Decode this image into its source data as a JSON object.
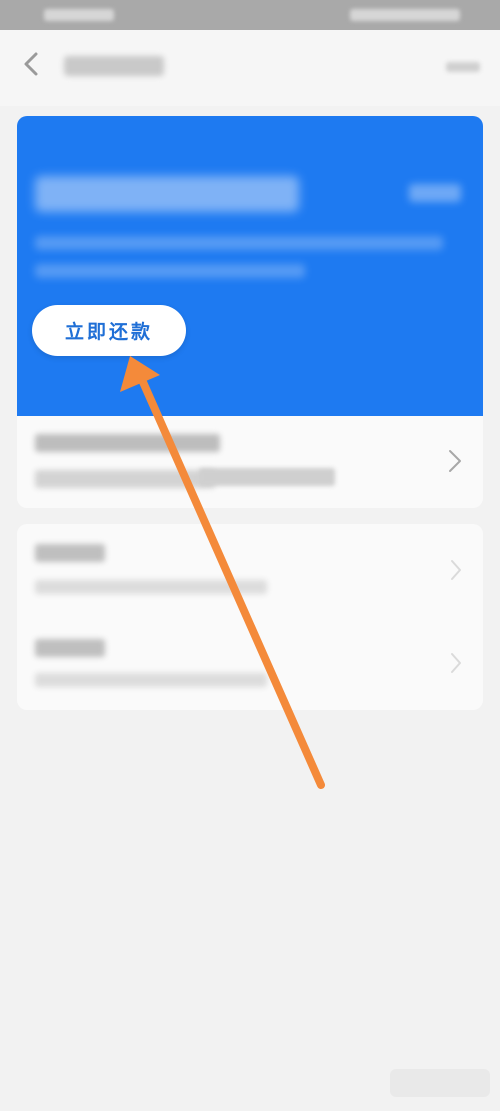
{
  "banner": {
    "repay_button_label": "立即还款",
    "accent_color": "#1e7af1"
  },
  "bill": {
    "chevron_icon": "chevron-right-icon"
  },
  "list": {
    "items": [
      {
        "chevron_icon": "chevron-right-icon"
      },
      {
        "chevron_icon": "chevron-right-icon"
      }
    ]
  },
  "annotation": {
    "arrow_color": "#f48a3a"
  },
  "watermark": {
    "icon": "baidu-jingyan-watermark"
  }
}
